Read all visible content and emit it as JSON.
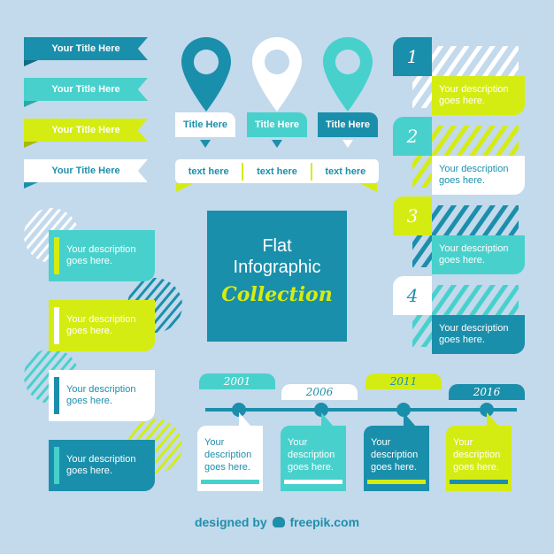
{
  "colors": {
    "background": "#c3d9ec",
    "dark_teal": "#1a8fab",
    "turquoise": "#48d1cc",
    "lime": "#d5ec13",
    "white": "#ffffff"
  },
  "ribbons": [
    {
      "label": "Your Title Here",
      "color": "dark_teal"
    },
    {
      "label": "Your Title Here",
      "color": "turquoise"
    },
    {
      "label": "Your Title Here",
      "color": "lime"
    },
    {
      "label": "Your Title Here",
      "color": "white"
    }
  ],
  "pins": [
    {
      "title": "Title Here",
      "color": "dark_teal"
    },
    {
      "title": "Title Here",
      "color": "white"
    },
    {
      "title": "Title Here",
      "color": "turquoise"
    }
  ],
  "text_bar": [
    "text here",
    "text here",
    "text here"
  ],
  "center": {
    "line1": "Flat",
    "line2": "Infographic",
    "line3": "Collection"
  },
  "left_cards": [
    {
      "text1": "Your description",
      "text2": "goes here."
    },
    {
      "text1": "Your description",
      "text2": "goes here."
    },
    {
      "text1": "Your description",
      "text2": "goes here."
    },
    {
      "text1": "Your description",
      "text2": "goes here."
    }
  ],
  "numbered_list": [
    {
      "number": "1",
      "text1": "Your description",
      "text2": "goes here."
    },
    {
      "number": "2",
      "text1": "Your description",
      "text2": "goes here."
    },
    {
      "number": "3",
      "text1": "Your description",
      "text2": "goes here."
    },
    {
      "number": "4",
      "text1": "Your description",
      "text2": "goes here."
    }
  ],
  "timeline": [
    {
      "year": "2001",
      "text1": "Your",
      "text2": "description",
      "text3": "goes here."
    },
    {
      "year": "2006",
      "text1": "Your",
      "text2": "description",
      "text3": "goes here."
    },
    {
      "year": "2011",
      "text1": "Your",
      "text2": "description",
      "text3": "goes here."
    },
    {
      "year": "2016",
      "text1": "Your",
      "text2": "description",
      "text3": "goes here."
    }
  ],
  "footer": {
    "prefix": "designed by",
    "brand": "freepik.com",
    "logo_icon": "freepik-logo-icon"
  }
}
